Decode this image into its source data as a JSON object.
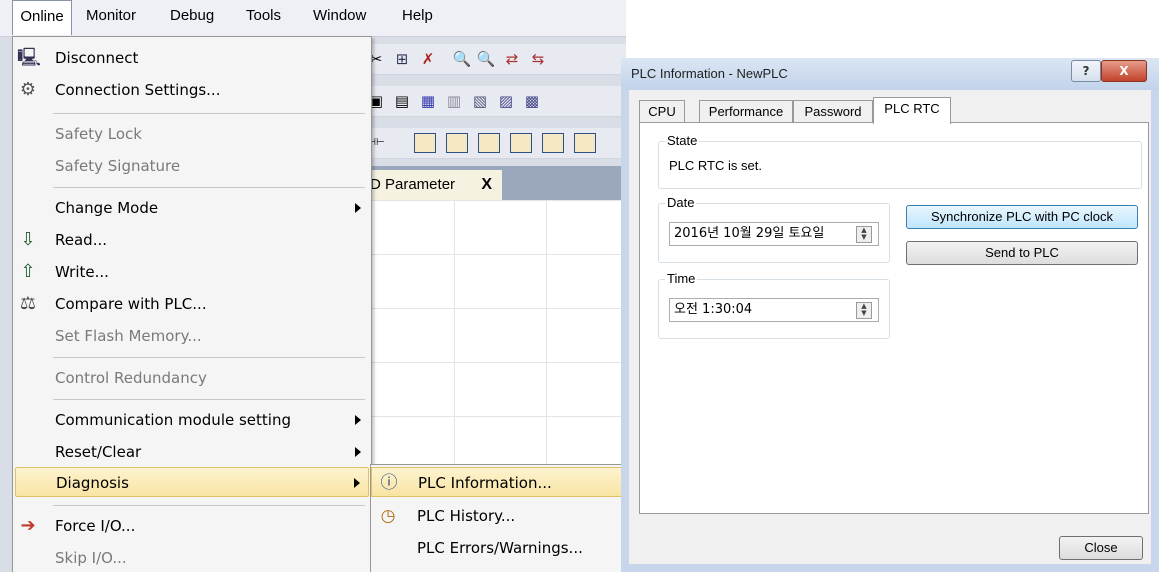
{
  "menubar": {
    "items": [
      "Online",
      "Monitor",
      "Debug",
      "Tools",
      "Window",
      "Help"
    ]
  },
  "online_menu": {
    "items": [
      {
        "label": "Disconnect",
        "icon": "disconnect-icon",
        "enabled": true
      },
      {
        "label": "Connection Settings...",
        "icon": "connection-settings-icon",
        "enabled": true
      },
      {
        "label": "Safety Lock",
        "enabled": false
      },
      {
        "label": "Safety Signature",
        "enabled": false
      },
      {
        "label": "Change Mode",
        "enabled": true,
        "submenu": true
      },
      {
        "label": "Read...",
        "icon": "read-icon",
        "enabled": true
      },
      {
        "label": "Write...",
        "icon": "write-icon",
        "enabled": true
      },
      {
        "label": "Compare with PLC...",
        "icon": "compare-icon",
        "enabled": true
      },
      {
        "label": "Set Flash Memory...",
        "enabled": false
      },
      {
        "label": "Control Redundancy",
        "enabled": false
      },
      {
        "label": "Communication module setting",
        "enabled": true,
        "submenu": true
      },
      {
        "label": "Reset/Clear",
        "enabled": true,
        "submenu": true
      },
      {
        "label": "Diagnosis",
        "enabled": true,
        "submenu": true,
        "highlighted": true
      },
      {
        "label": "Force I/O...",
        "icon": "force-io-icon",
        "enabled": true
      },
      {
        "label": "Skip I/O...",
        "enabled": false
      }
    ]
  },
  "diagnosis_submenu": {
    "items": [
      {
        "label": "PLC Information...",
        "icon": "plc-information-icon",
        "highlighted": true
      },
      {
        "label": "PLC History...",
        "icon": "plc-history-icon"
      },
      {
        "label": "PLC Errors/Warnings..."
      }
    ]
  },
  "editor_tab": {
    "label": "D Parameter",
    "close": "X"
  },
  "dialog": {
    "title": "PLC Information - NewPLC",
    "help_button": "?",
    "close_button": "X",
    "tabs": [
      "CPU",
      "Performance",
      "Password",
      "PLC RTC"
    ],
    "active_tab": "PLC RTC",
    "state": {
      "label": "State",
      "text": "PLC RTC is set."
    },
    "date": {
      "label": "Date",
      "value": "2016년 10월 29일 토요일"
    },
    "time": {
      "label": "Time",
      "value": "오전 1:30:04"
    },
    "sync_button": "Synchronize PLC with PC clock",
    "send_button": "Send to PLC",
    "footer_close": "Close"
  },
  "colors": {
    "menu_highlight": "#f8e4a3",
    "dialog_frame": "#c7d6ea",
    "close_red": "#c2432b"
  }
}
